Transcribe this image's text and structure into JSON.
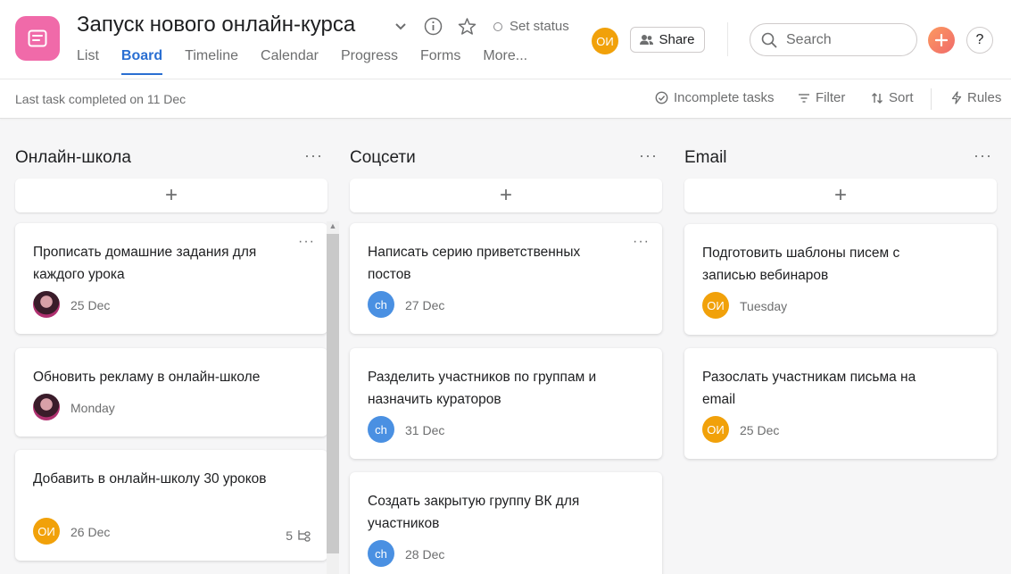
{
  "project": {
    "title": "Запуск нового онлайн-курса",
    "icon": "board-icon",
    "icon_color": "#f06aa9",
    "status_label": "Set status"
  },
  "tabs": [
    {
      "label": "List"
    },
    {
      "label": "Board",
      "active": true
    },
    {
      "label": "Timeline"
    },
    {
      "label": "Calendar"
    },
    {
      "label": "Progress"
    },
    {
      "label": "Forms"
    },
    {
      "label": "More..."
    }
  ],
  "header": {
    "member_initials": "ОИ",
    "share_label": "Share",
    "search_placeholder": "Search",
    "help_label": "?"
  },
  "toolbar": {
    "last_task": "Last task completed on 11 Dec",
    "incomplete_label": "Incomplete tasks",
    "filter_label": "Filter",
    "sort_label": "Sort",
    "rules_label": "Rules"
  },
  "columns": [
    {
      "title": "Онлайн-школа",
      "add_label": "+",
      "cards": [
        {
          "title": "Прописать домашние задания для каждого урока",
          "assignee": "photo",
          "date": "25 Dec"
        },
        {
          "title": "Обновить рекламу в онлайн-школе",
          "assignee": "photo",
          "date": "Monday"
        },
        {
          "title": "Добавить в онлайн-школу 30 уроков",
          "assignee": "ОИ",
          "date": "26 Dec",
          "subtasks": "5"
        }
      ]
    },
    {
      "title": "Соцсети",
      "add_label": "+",
      "cards": [
        {
          "title": "Написать серию приветственных постов",
          "assignee": "ch",
          "date": "27 Dec"
        },
        {
          "title": "Разделить участников по группам и назначить кураторов",
          "assignee": "ch",
          "date": "31 Dec"
        },
        {
          "title": "Создать закрытую группу ВК для участников",
          "assignee": "ch",
          "date": "28 Dec"
        }
      ]
    },
    {
      "title": "Email",
      "add_label": "+",
      "cards": [
        {
          "title": "Подготовить шаблоны писем с записью вебинаров",
          "assignee": "ОИ",
          "date": "Tuesday"
        },
        {
          "title": "Разослать участникам письма на email",
          "assignee": "ОИ",
          "date": "25 Dec"
        }
      ]
    }
  ],
  "colors": {
    "accent": "#2a6fd2",
    "orange_avatar": "#f1a10a",
    "blue_avatar": "#4a90e2"
  }
}
